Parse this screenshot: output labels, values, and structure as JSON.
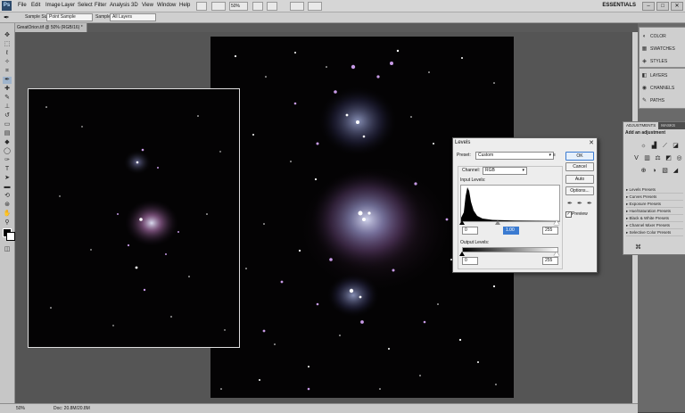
{
  "app": {
    "logo": "Ps",
    "menus": [
      "File",
      "Edit",
      "Image",
      "Layer",
      "Select",
      "Filter",
      "Analysis",
      "3D",
      "View",
      "Window",
      "Help"
    ],
    "zoom_box": "50%",
    "workspace": "ESSENTIALS",
    "window_controls": [
      "–",
      "□",
      "✕"
    ]
  },
  "options": {
    "sample_size_label": "Sample Size:",
    "sample_size_value": "Point Sample",
    "sample_label": "Sample:",
    "sample_value": "All Layers"
  },
  "document": {
    "tab_title": "GreatOrion.tif @ 50% (RGB/16) *",
    "tab_close": "×"
  },
  "status": {
    "zoom": "50%",
    "doc_info": "Doc: 20.8M/20.8M"
  },
  "dock": {
    "group1": [
      {
        "icon": "color-icon",
        "glyph": "◐",
        "label": "COLOR"
      },
      {
        "icon": "swatches-icon",
        "glyph": "▦",
        "label": "SWATCHES"
      },
      {
        "icon": "styles-icon",
        "glyph": "◈",
        "label": "STYLES"
      }
    ],
    "group2": [
      {
        "icon": "layers-icon",
        "glyph": "◧",
        "label": "LAYERS"
      },
      {
        "icon": "channels-icon",
        "glyph": "◉",
        "label": "CHANNELS"
      },
      {
        "icon": "paths-icon",
        "glyph": "✎",
        "label": "PATHS"
      }
    ]
  },
  "adjustments": {
    "tabs": [
      "ADJUSTMENTS",
      "MASKS"
    ],
    "title": "Add an adjustment",
    "presets": [
      "Levels Presets",
      "Curves Presets",
      "Exposure Presets",
      "Hue/Saturation Presets",
      "Black & White Presets",
      "Channel Mixer Presets",
      "Selective Color Presets"
    ]
  },
  "levels": {
    "title": "Levels",
    "close": "✕",
    "preset_label": "Preset:",
    "preset_value": "Custom",
    "channel_label": "Channel:",
    "channel_value": "RGB",
    "input_label": "Input Levels:",
    "input_black": "0",
    "input_gamma": "1.00",
    "input_white": "255",
    "output_label": "Output Levels:",
    "output_black": "0",
    "output_white": "255",
    "buttons": {
      "ok": "OK",
      "cancel": "Cancel",
      "auto": "Auto",
      "options": "Options..."
    },
    "preview_label": "Preview",
    "preview_checked": true
  },
  "colors": {
    "accent": "#3b7bd1",
    "canvas_bg": "#555555",
    "space": "#040304"
  }
}
